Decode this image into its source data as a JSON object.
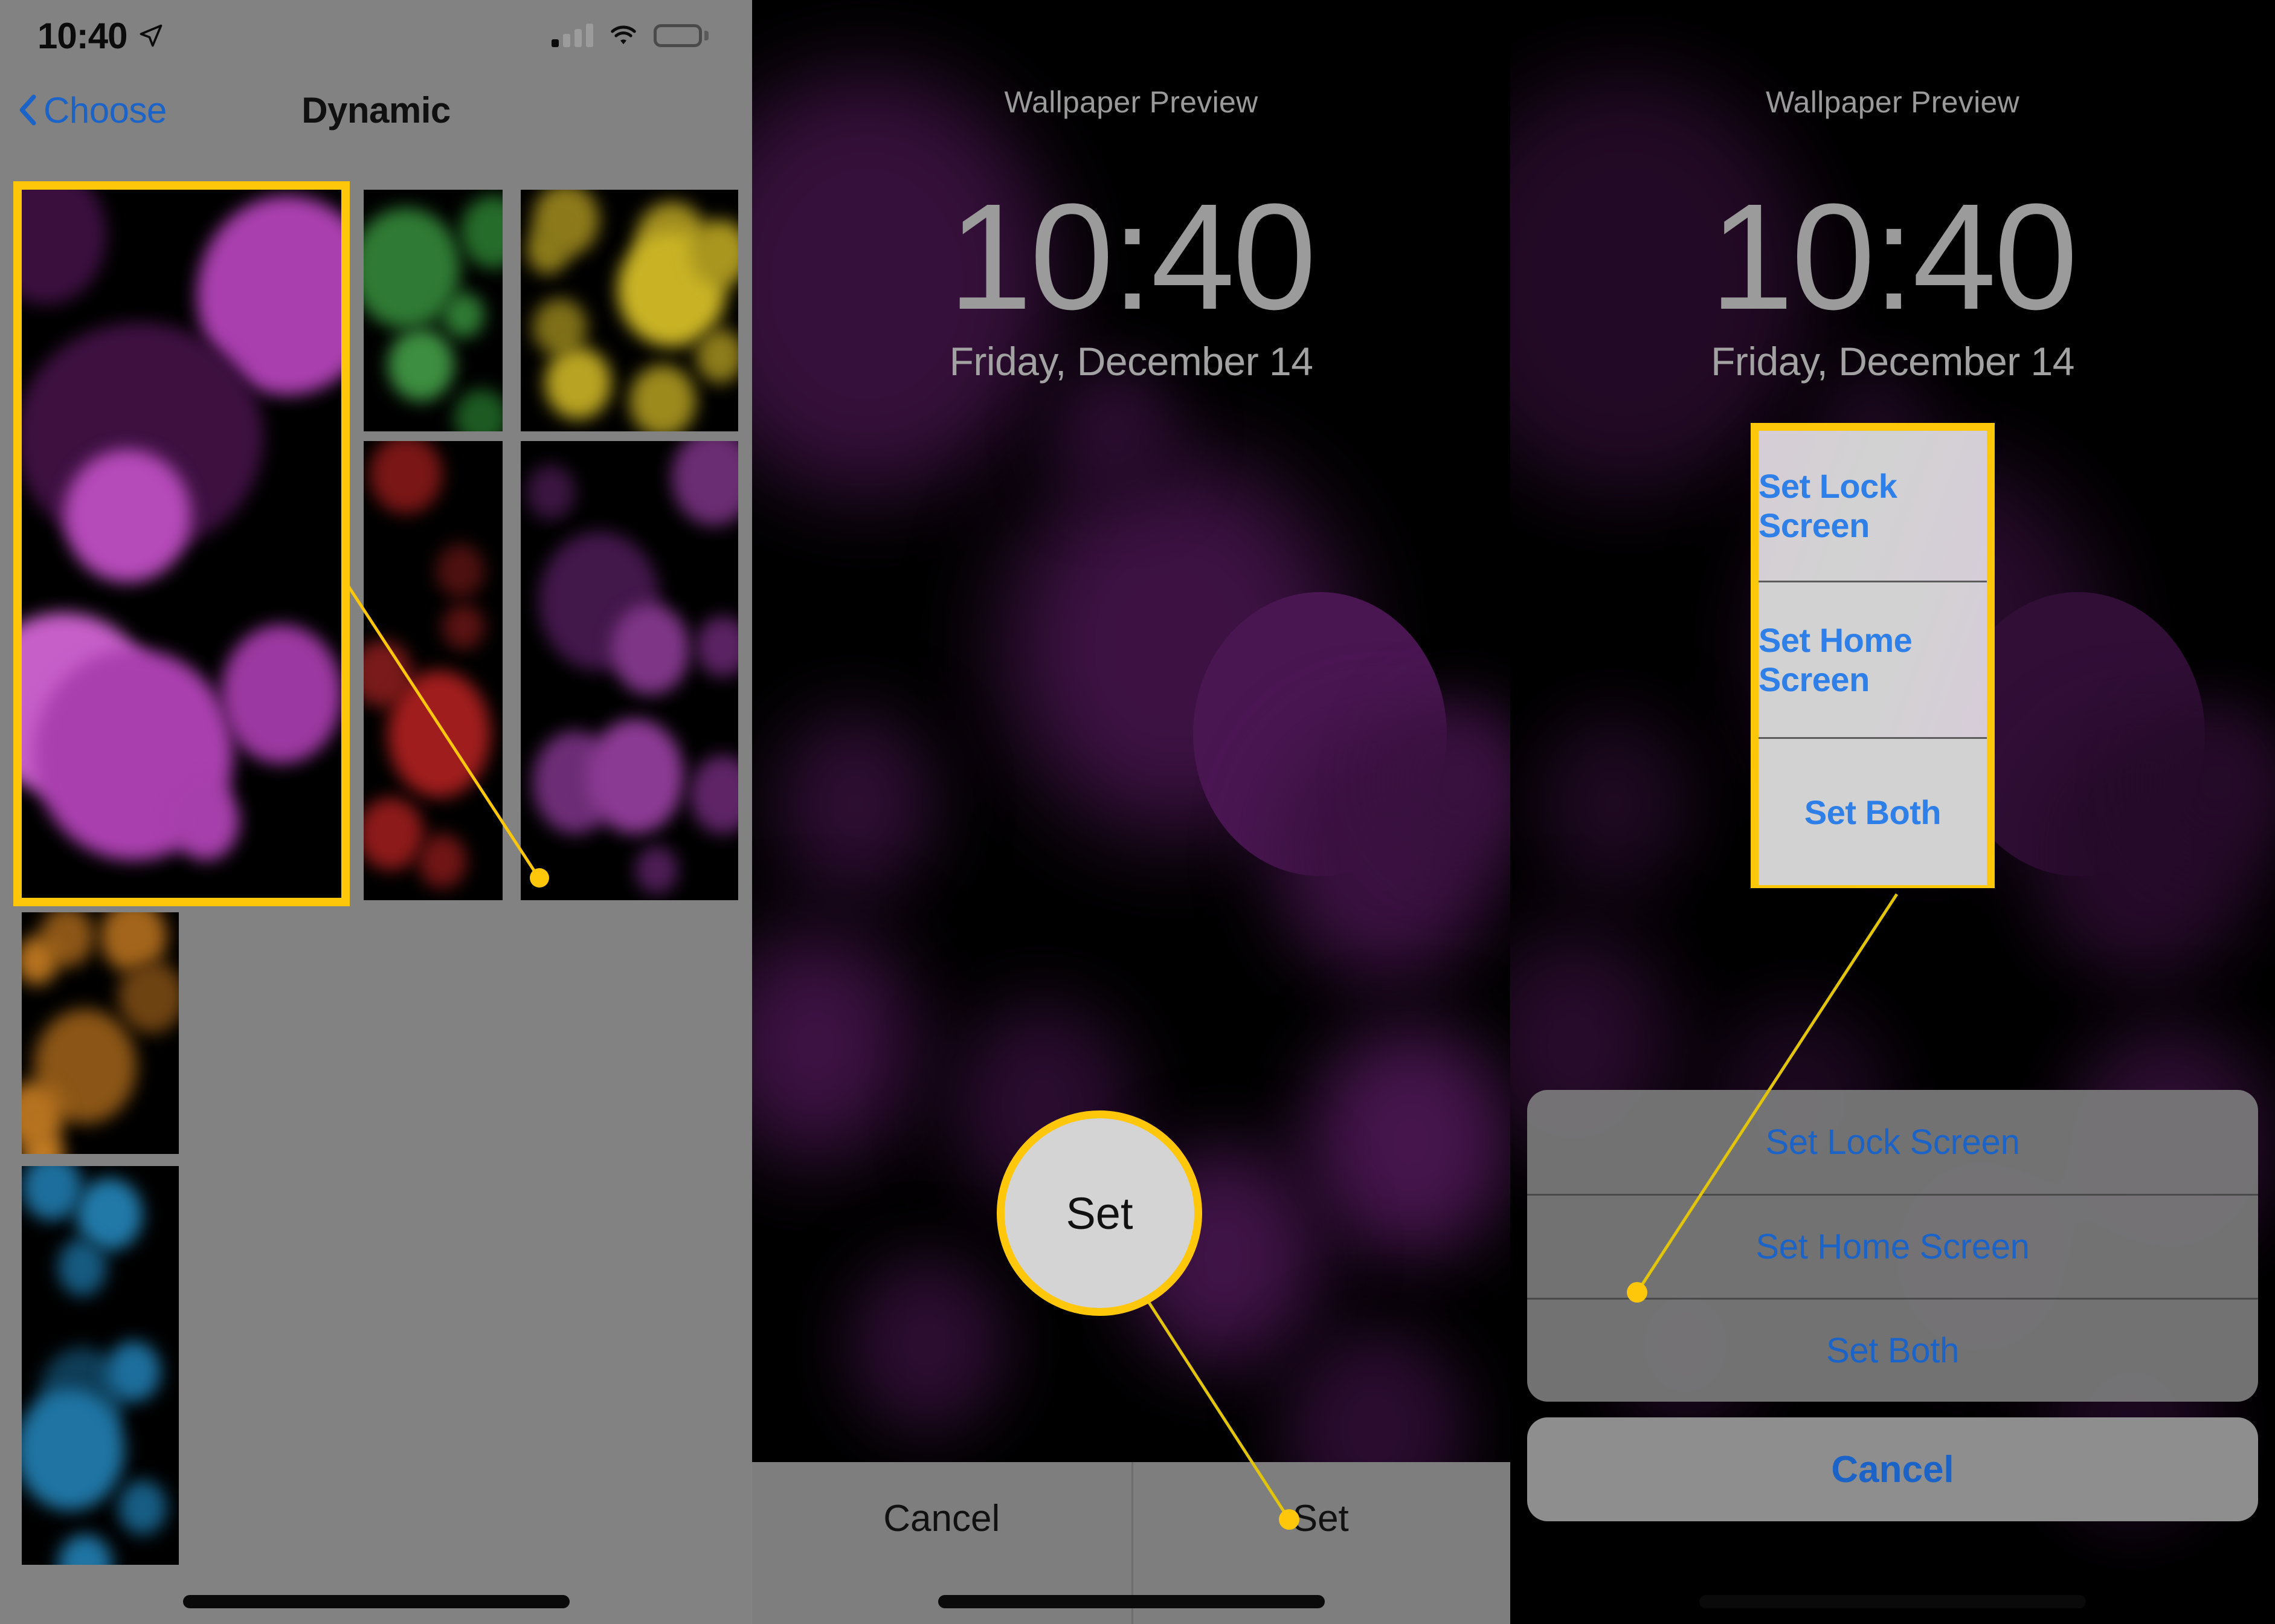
{
  "panel_chooser": {
    "status_bar": {
      "time": "10:40",
      "location_icon": "location-arrow-icon",
      "signal_icon": "cellular-signal-icon",
      "wifi_icon": "wifi-icon",
      "battery_icon": "battery-full-icon"
    },
    "nav": {
      "back_label": "Choose",
      "back_icon": "chevron-left-icon",
      "title": "Dynamic"
    },
    "thumbnails": [
      {
        "id": "thumb-purple-selected",
        "color": "#a93fae",
        "selected": true
      },
      {
        "id": "thumb-green",
        "color": "#2f7a34",
        "selected": false
      },
      {
        "id": "thumb-yellow",
        "color": "#c9b325",
        "selected": false
      },
      {
        "id": "thumb-dark-purple",
        "color": "#5a2a62",
        "selected": false
      },
      {
        "id": "thumb-orange",
        "color": "#b5721f",
        "selected": false
      },
      {
        "id": "thumb-red",
        "color": "#a01d1d",
        "selected": false
      },
      {
        "id": "thumb-blue",
        "color": "#1d6e9c",
        "selected": false
      }
    ]
  },
  "panel_preview": {
    "label": "Wallpaper Preview",
    "clock": "10:40",
    "date": "Friday, December 14",
    "cancel_label": "Cancel",
    "set_label": "Set"
  },
  "panel_sheet": {
    "label": "Wallpaper Preview",
    "clock": "10:40",
    "date": "Friday, December 14",
    "options": [
      "Set Lock Screen",
      "Set Home Screen",
      "Set Both"
    ],
    "cancel_label": "Cancel"
  },
  "callouts": {
    "accent_color": "#FFC709",
    "set_button": {
      "label": "Set"
    },
    "sheet_box": {
      "options": [
        "Set Lock Screen",
        "Set Home Screen",
        "Set Both"
      ]
    }
  }
}
